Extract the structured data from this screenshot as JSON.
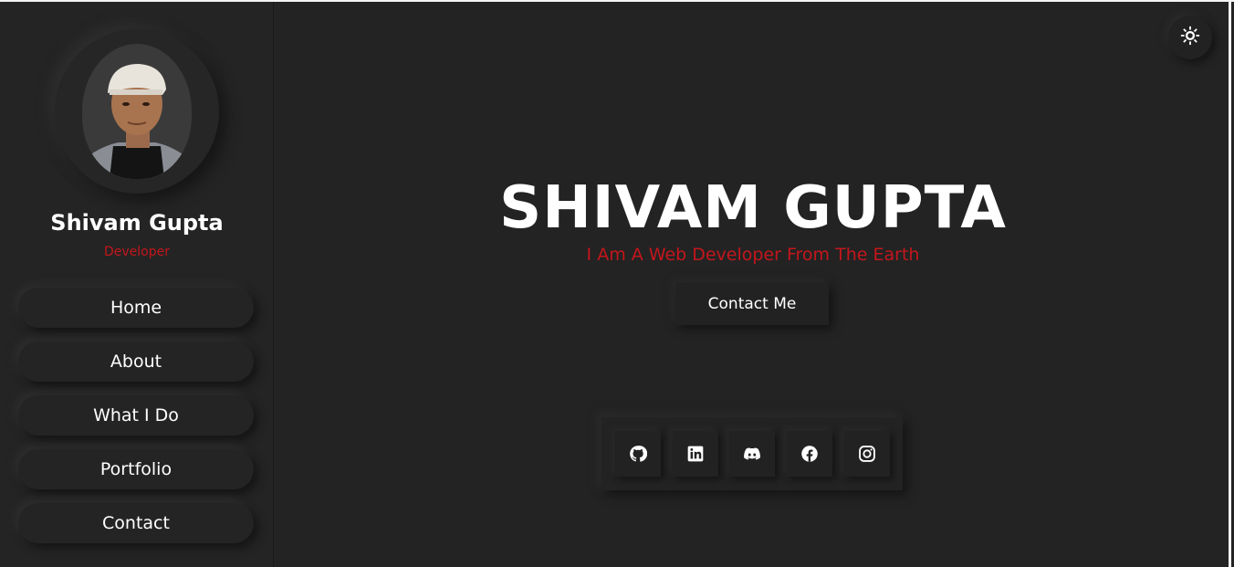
{
  "sidebar": {
    "profile": {
      "name": "Shivam Gupta",
      "role": "Developer"
    },
    "nav": [
      {
        "label": "Home"
      },
      {
        "label": "About"
      },
      {
        "label": "What I Do"
      },
      {
        "label": "Portfolio"
      },
      {
        "label": "Contact"
      }
    ]
  },
  "hero": {
    "title": "SHIVAM GUPTA",
    "subtitle": "I Am A Web Developer From The Earth",
    "cta_label": "Contact Me"
  },
  "social": [
    {
      "icon": "github-icon"
    },
    {
      "icon": "linkedin-icon"
    },
    {
      "icon": "discord-icon"
    },
    {
      "icon": "facebook-icon"
    },
    {
      "icon": "instagram-icon"
    }
  ],
  "theme_toggle": {
    "icon": "sun-icon"
  },
  "colors": {
    "background": "#232323",
    "accent": "#c4161c",
    "text": "#ffffff"
  }
}
